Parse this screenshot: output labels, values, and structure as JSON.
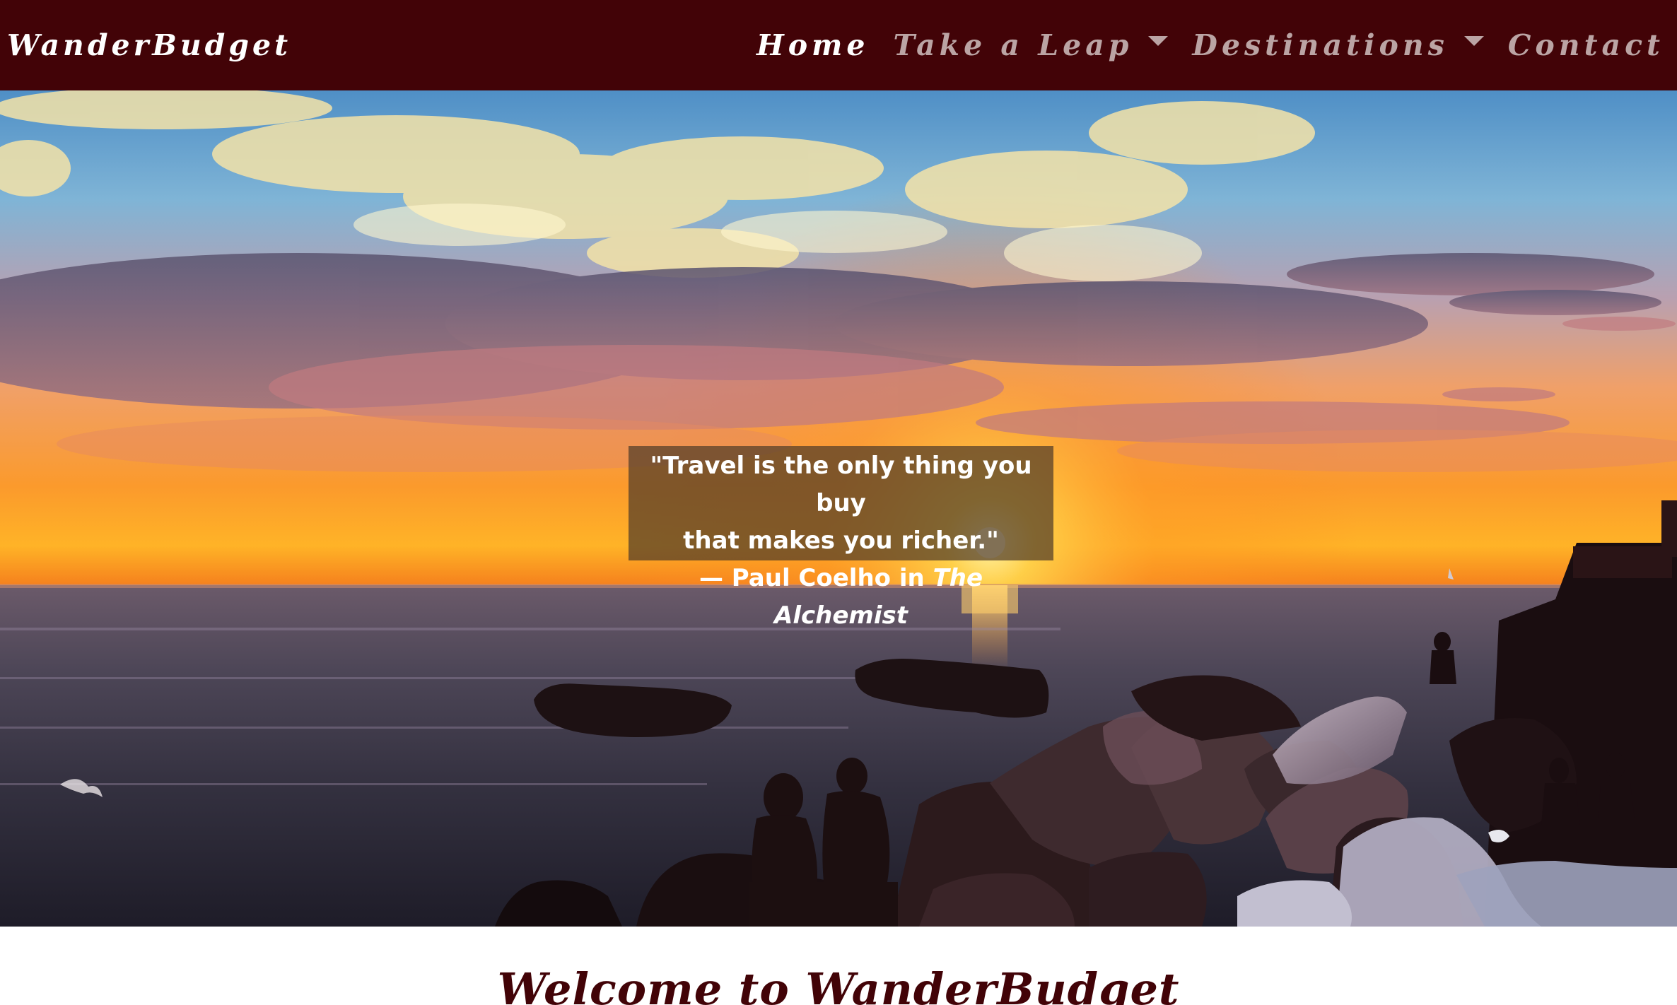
{
  "navbar": {
    "brand": "WanderBudget",
    "items": [
      {
        "label": "Home",
        "active": true,
        "dropdown": false
      },
      {
        "label": "Take a Leap",
        "active": false,
        "dropdown": true
      },
      {
        "label": "Destinations",
        "active": false,
        "dropdown": true
      },
      {
        "label": "Contact",
        "active": false,
        "dropdown": false
      }
    ]
  },
  "hero": {
    "quote_line1": "\"Travel is the only thing you buy",
    "quote_line2": "that makes you richer.\"",
    "attribution_prefix": "—  Paul Coelho in ",
    "attribution_title": "The Alchemist"
  },
  "welcome": {
    "heading": "Welcome to WanderBudget"
  },
  "colors": {
    "navbar_bg": "#420307",
    "nav_active": "#ffffff",
    "nav_inactive": "#bba4a4",
    "heading": "#420307"
  }
}
